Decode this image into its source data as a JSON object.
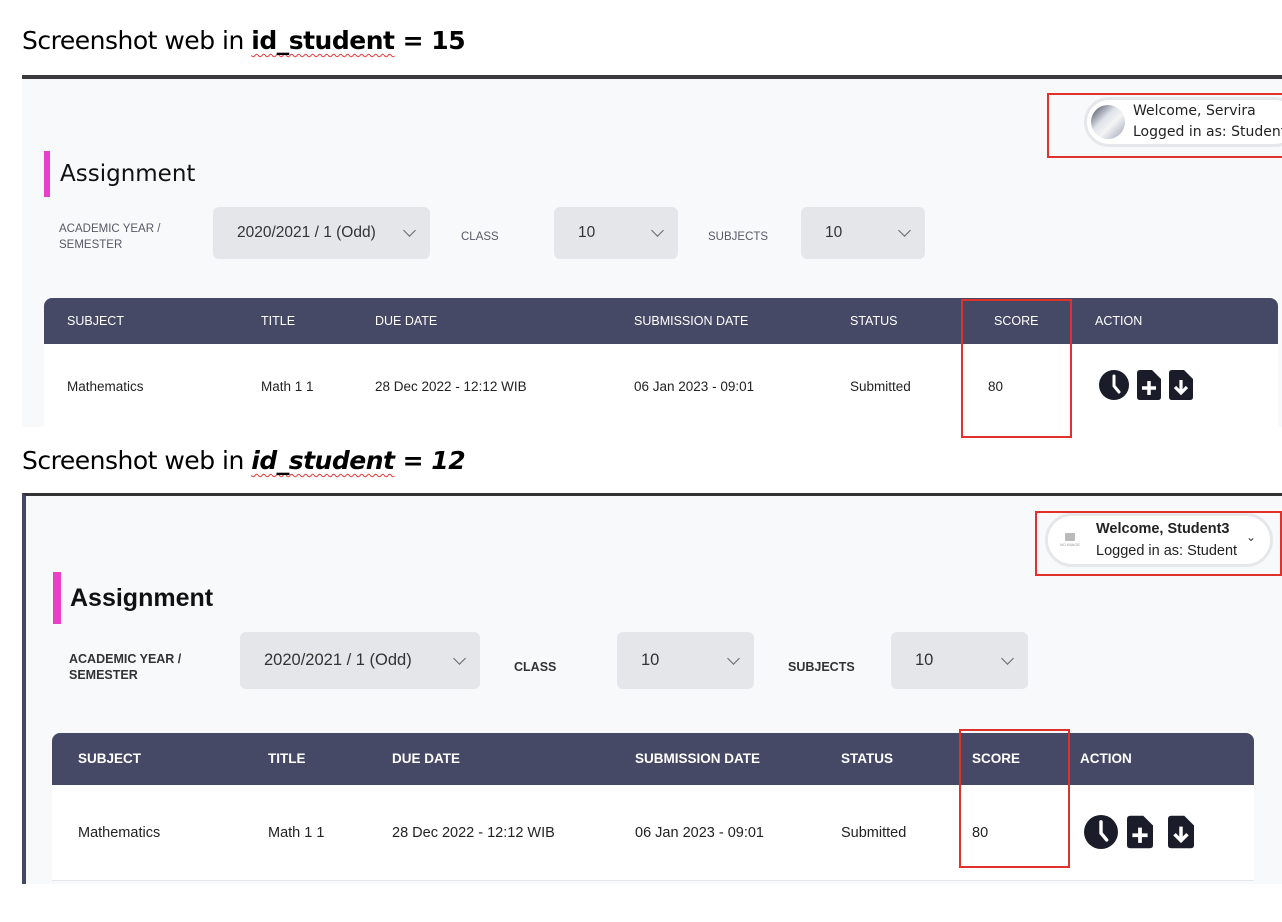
{
  "captions": [
    {
      "prefix": "Screenshot web in ",
      "keyword": "id_student",
      "suffix": " = 15"
    },
    {
      "prefix": "Screenshot web in ",
      "keyword": "id_student",
      "suffix": " = 12"
    }
  ],
  "screens": [
    {
      "user": {
        "welcome": "Welcome, Servira",
        "role": "Logged in as: Student",
        "avatar_icon": "user-photo-icon"
      },
      "page_title": "Assignment",
      "filters": {
        "academic_label_line1": "ACADEMIC YEAR /",
        "academic_label_line2": "SEMESTER",
        "academic_value": "2020/2021 / 1 (Odd)",
        "class_label": "CLASS",
        "class_value": "10",
        "subjects_label": "SUBJECTS",
        "subjects_value": "10"
      },
      "table": {
        "headers": [
          "SUBJECT",
          "TITLE",
          "DUE DATE",
          "SUBMISSION DATE",
          "STATUS",
          "SCORE",
          "ACTION"
        ],
        "rows": [
          {
            "subject": "Mathematics",
            "title": "Math 1 1",
            "due_date": "28 Dec 2022 - 12:12 WIB",
            "submission_date": "06 Jan 2023 - 09:01",
            "status": "Submitted",
            "score": "80",
            "actions": [
              "clock-icon",
              "file-plus-icon",
              "file-download-icon"
            ]
          }
        ]
      }
    },
    {
      "user": {
        "welcome": "Welcome, Student3",
        "role": "Logged in as: Student",
        "avatar_icon": "no-image-icon",
        "avatar_text": "NO IMAGE"
      },
      "page_title": "Assignment",
      "filters": {
        "academic_label_line1": "ACADEMIC YEAR /",
        "academic_label_line2": "SEMESTER",
        "academic_value": "2020/2021 / 1 (Odd)",
        "class_label": "CLASS",
        "class_value": "10",
        "subjects_label": "SUBJECTS",
        "subjects_value": "10"
      },
      "table": {
        "headers": [
          "SUBJECT",
          "TITLE",
          "DUE DATE",
          "SUBMISSION DATE",
          "STATUS",
          "SCORE",
          "ACTION"
        ],
        "rows": [
          {
            "subject": "Mathematics",
            "title": "Math 1 1",
            "due_date": "28 Dec 2022 - 12:12 WIB",
            "submission_date": "06 Jan 2023 - 09:01",
            "status": "Submitted",
            "score": "80",
            "actions": [
              "clock-icon",
              "file-plus-icon",
              "file-download-icon"
            ]
          }
        ]
      }
    }
  ],
  "colors": {
    "accent_pink": "#ea3fc8",
    "table_header": "#454966",
    "highlight_red": "#e0322b"
  }
}
